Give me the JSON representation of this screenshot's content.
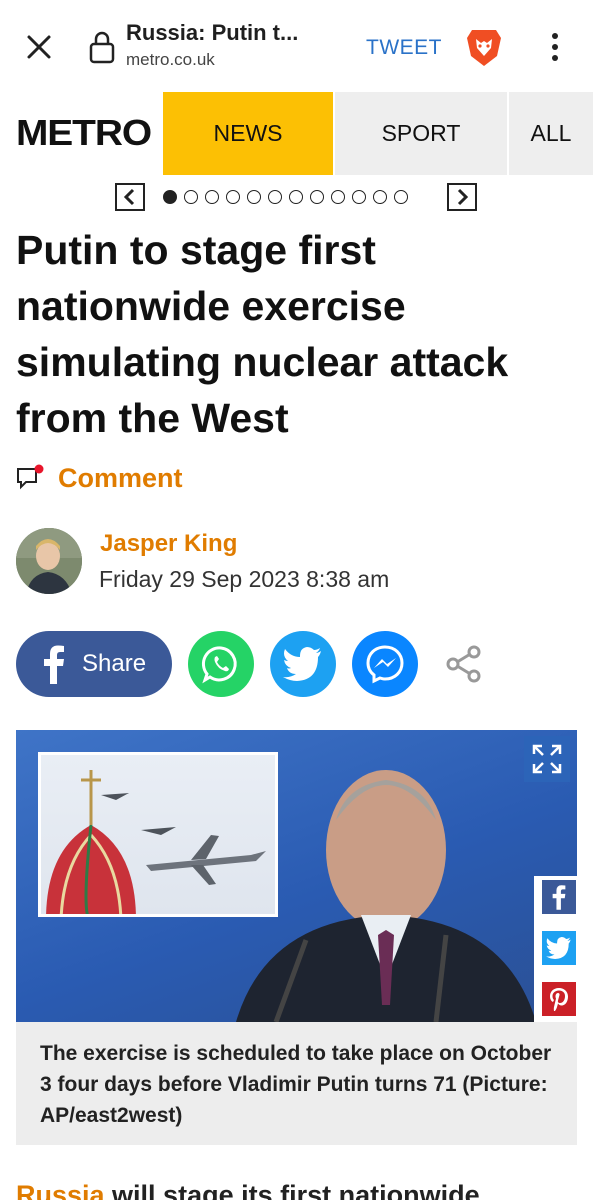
{
  "browser": {
    "title": "Russia: Putin t...",
    "domain": "metro.co.uk",
    "tweet_label": "TWEET"
  },
  "nav": {
    "logo": "METRO",
    "tabs": [
      "NEWS",
      "SPORT",
      "ALL"
    ],
    "active_tab": "NEWS",
    "accent_color": "#fcc004"
  },
  "carousel": {
    "dot_count": 12,
    "active_index": 0
  },
  "article": {
    "headline": "Putin to stage first nationwide exercise simulating nuclear attack from the West",
    "comment_label": "Comment",
    "author": "Jasper King",
    "date": "Friday 29 Sep 2023 8:38 am",
    "share_label": "Share",
    "caption": "The exercise is scheduled to take place on October 3 four days before Vladimir Putin turns 71 (Picture: AP/east2west)",
    "body_link": "Russia",
    "body_text": " will stage its first nationwide"
  },
  "icons": {
    "close": "close-icon",
    "lock": "lock-icon",
    "brave": "brave-lion-icon",
    "menu": "more-vertical-icon",
    "comment": "comment-icon",
    "facebook": "facebook-icon",
    "whatsapp": "whatsapp-icon",
    "twitter": "twitter-icon",
    "messenger": "messenger-icon",
    "share": "share-icon",
    "expand": "expand-icon",
    "pinterest": "pinterest-icon"
  },
  "colors": {
    "orange": "#e07c00",
    "facebook": "#3b5998",
    "whatsapp": "#25d366",
    "twitter": "#1da1f2",
    "messenger": "#0a86ff",
    "pinterest": "#cb2027"
  }
}
